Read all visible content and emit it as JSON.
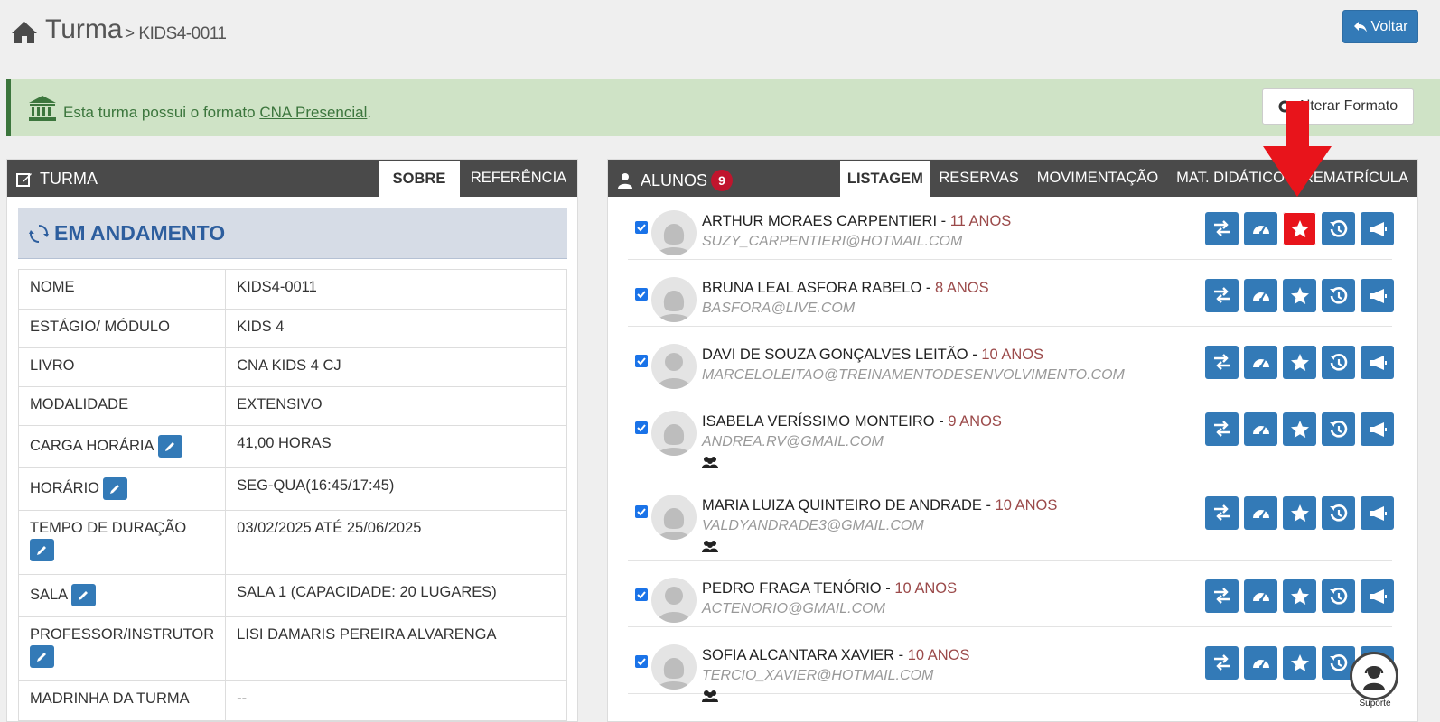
{
  "header": {
    "title": "Turma",
    "separator": ">",
    "code": "KIDS4-0011",
    "back_label": "Voltar"
  },
  "alert": {
    "text_before": "Esta turma possui o formato ",
    "link": "CNA Presencial",
    "text_after": ".",
    "button_label": "Alterar Formato"
  },
  "turma_panel": {
    "title": "TURMA",
    "tabs": [
      {
        "label": "SOBRE",
        "active": true
      },
      {
        "label": "REFERÊNCIA",
        "active": false
      }
    ],
    "status": "EM ANDAMENTO",
    "rows": [
      {
        "key": "NOME",
        "value": "KIDS4-0011",
        "editable": false
      },
      {
        "key": "ESTÁGIO/ MÓDULO",
        "value": "KIDS 4",
        "editable": false
      },
      {
        "key": "LIVRO",
        "value": "CNA KIDS 4 CJ",
        "editable": false
      },
      {
        "key": "MODALIDADE",
        "value": "EXTENSIVO",
        "editable": false
      },
      {
        "key": "CARGA HORÁRIA",
        "value": "41,00 HORAS",
        "editable": true
      },
      {
        "key": "HORÁRIO",
        "value": "SEG-QUA(16:45/17:45)",
        "editable": true
      },
      {
        "key": "TEMPO DE DURAÇÃO",
        "value": "03/02/2025 ATÉ 25/06/2025",
        "editable": true
      },
      {
        "key": "SALA",
        "value": "SALA 1 (CAPACIDADE: 20 LUGARES)",
        "editable": true
      },
      {
        "key": "PROFESSOR/INSTRUTOR",
        "value": "LISI DAMARIS PEREIRA ALVARENGA",
        "editable": true
      },
      {
        "key": "MADRINHA DA TURMA",
        "value": "--",
        "editable": false
      }
    ]
  },
  "alunos_panel": {
    "title": "ALUNOS",
    "count": "9",
    "tabs": [
      {
        "label": "LISTAGEM",
        "active": true
      },
      {
        "label": "RESERVAS",
        "active": false
      },
      {
        "label": "MOVIMENTAÇÃO",
        "active": false
      },
      {
        "label": "MAT. DIDÁTICO",
        "active": false
      },
      {
        "label": "REMATRÍCULA",
        "active": false
      }
    ],
    "students": [
      {
        "name": "ARTHUR MORAES CARPENTIERI",
        "age": "11 ANOS",
        "email": "SUZY_CARPENTIERI@HOTMAIL.COM",
        "gender": "female",
        "group": false,
        "highlight": true
      },
      {
        "name": "BRUNA LEAL ASFORA RABELO",
        "age": "8 ANOS",
        "email": "BASFORA@LIVE.COM",
        "gender": "female",
        "group": false,
        "highlight": false
      },
      {
        "name": "DAVI DE SOUZA GONÇALVES LEITÃO",
        "age": "10 ANOS",
        "email": "MARCELOLEITAO@TREINAMENTODESENVOLVIMENTO.COM",
        "gender": "male",
        "group": false,
        "highlight": false
      },
      {
        "name": "ISABELA VERÍSSIMO MONTEIRO",
        "age": "9 ANOS",
        "email": "ANDREA.RV@GMAIL.COM",
        "gender": "female",
        "group": true,
        "highlight": false
      },
      {
        "name": "MARIA LUIZA QUINTEIRO DE ANDRADE",
        "age": "10 ANOS",
        "email": "VALDYANDRADE3@GMAIL.COM",
        "gender": "female",
        "group": true,
        "highlight": false
      },
      {
        "name": "PEDRO FRAGA TENÓRIO",
        "age": "10 ANOS",
        "email": "ACTENORIO@GMAIL.COM",
        "gender": "male",
        "group": false,
        "highlight": false
      },
      {
        "name": "SOFIA ALCANTARA XAVIER",
        "age": "10 ANOS",
        "email": "TERCIO_XAVIER@HOTMAIL.COM",
        "gender": "female",
        "group": true,
        "highlight": false
      }
    ],
    "name_separator": " - "
  },
  "support": {
    "label": "Suporte"
  },
  "colors": {
    "primary": "#337ab7",
    "highlight": "#e8141b",
    "success_bg": "#cfe3c6",
    "dark_header": "#4a4a4a"
  }
}
